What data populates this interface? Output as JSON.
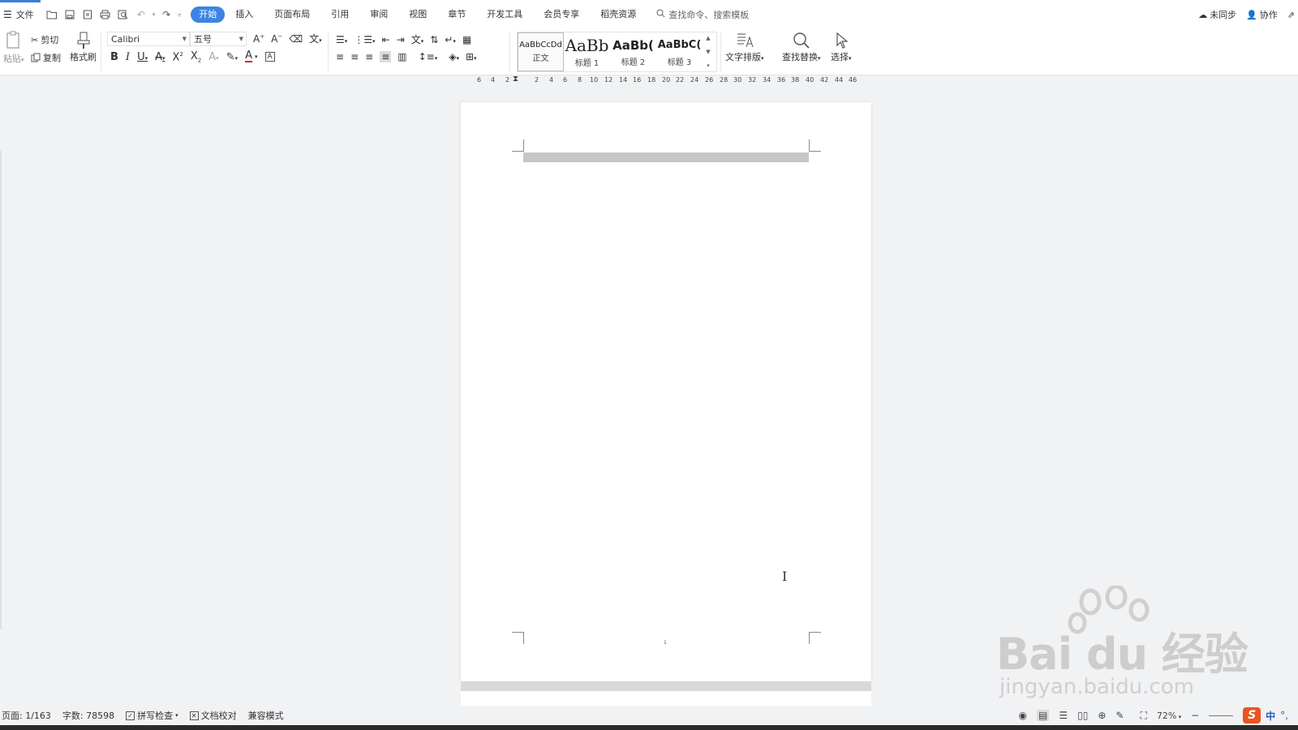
{
  "menubar": {
    "file_label": "文件",
    "tabs": [
      "开始",
      "插入",
      "页面布局",
      "引用",
      "审阅",
      "视图",
      "章节",
      "开发工具",
      "会员专享",
      "稻壳资源"
    ],
    "search_placeholder": "查找命令、搜索模板",
    "sync_label": "未同步",
    "collab_label": "协作"
  },
  "ribbon": {
    "paste_label": "粘贴",
    "cut_label": "剪切",
    "copy_label": "复制",
    "format_painter_label": "格式刷",
    "font_name": "Calibri",
    "font_size": "五号",
    "styles": [
      {
        "sample": "AaBbCcDd",
        "label": "正文"
      },
      {
        "sample": "AaBb",
        "label": "标题 1"
      },
      {
        "sample": "AaBb(",
        "label": "标题 2"
      },
      {
        "sample": "AaBbC(",
        "label": "标题 3"
      }
    ],
    "text_layout_label": "文字排版",
    "find_replace_label": "查找替换",
    "select_label": "选择"
  },
  "ruler": {
    "ticks": [
      "6",
      "4",
      "2",
      "2",
      "4",
      "6",
      "8",
      "10",
      "12",
      "14",
      "16",
      "18",
      "20",
      "22",
      "24",
      "26",
      "28",
      "30",
      "32",
      "34",
      "36",
      "38",
      "40",
      "42",
      "44",
      "46"
    ]
  },
  "page": {
    "page_number": "1"
  },
  "statusbar": {
    "page_info": "页面: 1/163",
    "word_count": "字数: 78598",
    "spell_check": "拼写检查",
    "doc_proof": "文档校对",
    "compat_mode": "兼容模式",
    "zoom": "72%",
    "ime_label": "中"
  },
  "watermark": {
    "brand": "Bai du 经验",
    "url": "jingyan.baidu.com"
  }
}
